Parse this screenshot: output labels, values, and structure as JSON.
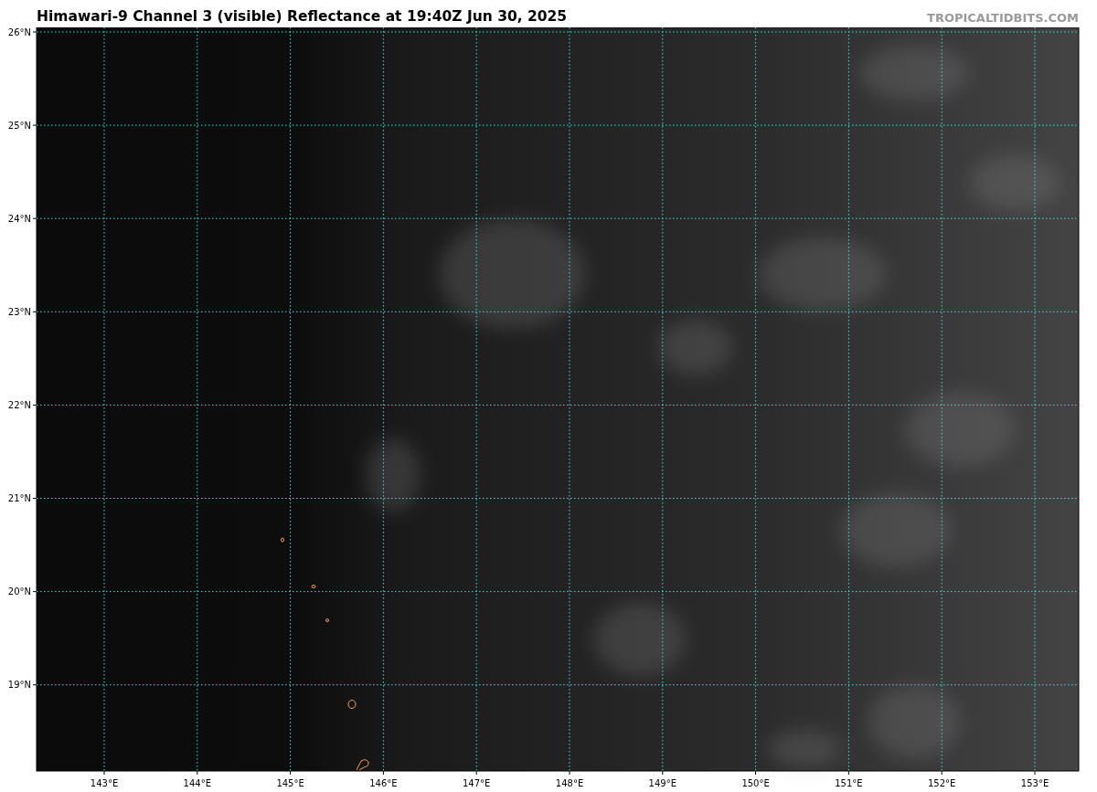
{
  "title": "Himawari-9 Channel 3 (visible) Reflectance at 19:40Z Jun 30, 2025",
  "credit": "TROPICALTIDBITS.COM",
  "map": {
    "lat_ticks": [
      "26°N",
      "25°N",
      "24°N",
      "23°N",
      "22°N",
      "21°N",
      "20°N",
      "19°N"
    ],
    "lon_ticks": [
      "143°E",
      "144°E",
      "145°E",
      "146°E",
      "147°E",
      "148°E",
      "149°E",
      "150°E",
      "151°E",
      "152°E",
      "153°E"
    ]
  }
}
